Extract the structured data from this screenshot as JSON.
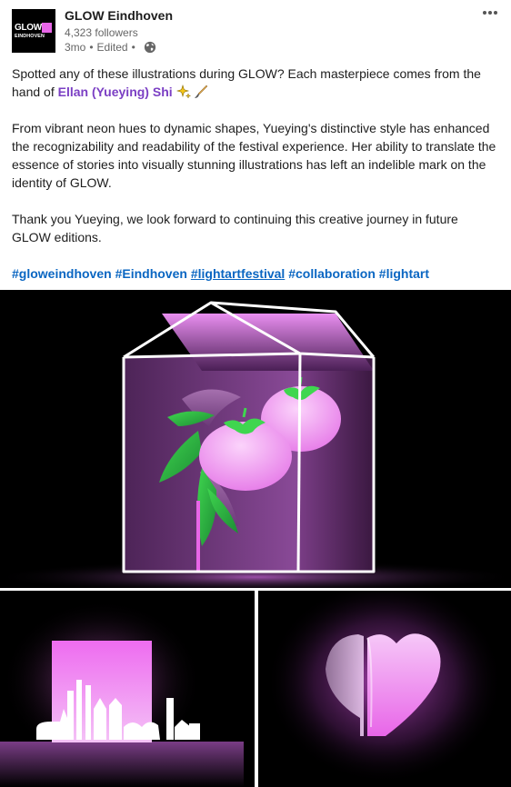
{
  "author": {
    "name": "GLOW Eindhoven",
    "followers": "4,323 followers",
    "time": "3mo",
    "edited": "Edited",
    "logo_line1": "GLOW",
    "logo_line2": "EINDHOVEN",
    "visibility_icon": "globe-icon",
    "menu_icon": "more-options-icon"
  },
  "post": {
    "p1_text": "Spotted any of these illustrations during GLOW? Each masterpiece comes from the hand of ",
    "mention": "Ellan (Yueying) Shi",
    "p1_emojis": "✨🖌️",
    "p2": "From vibrant neon hues to dynamic shapes, Yueying's distinctive style has enhanced the recognizability and readability of the festival experience. Her ability to translate the essence of stories into visually stunning illustrations has left an indelible mark on the identity of GLOW.",
    "p3": "Thank you Yueying, we look forward to continuing this creative journey in future GLOW editions.",
    "hashtags": [
      "#gloweindhoven",
      "#Eindhoven",
      "#lightartfestival",
      "#collaboration",
      "#lightart"
    ]
  },
  "images": [
    {
      "subject": "greenhouse with tomatoes illustration"
    },
    {
      "subject": "glowing city skyline illustration"
    },
    {
      "subject": "glowing heart illustration"
    }
  ],
  "colors": {
    "accent_pink": "#e866e8",
    "hashtag_blue": "#0a66c2",
    "mention_purple": "#7b3fc4",
    "leaf_green": "#3fd64f"
  }
}
